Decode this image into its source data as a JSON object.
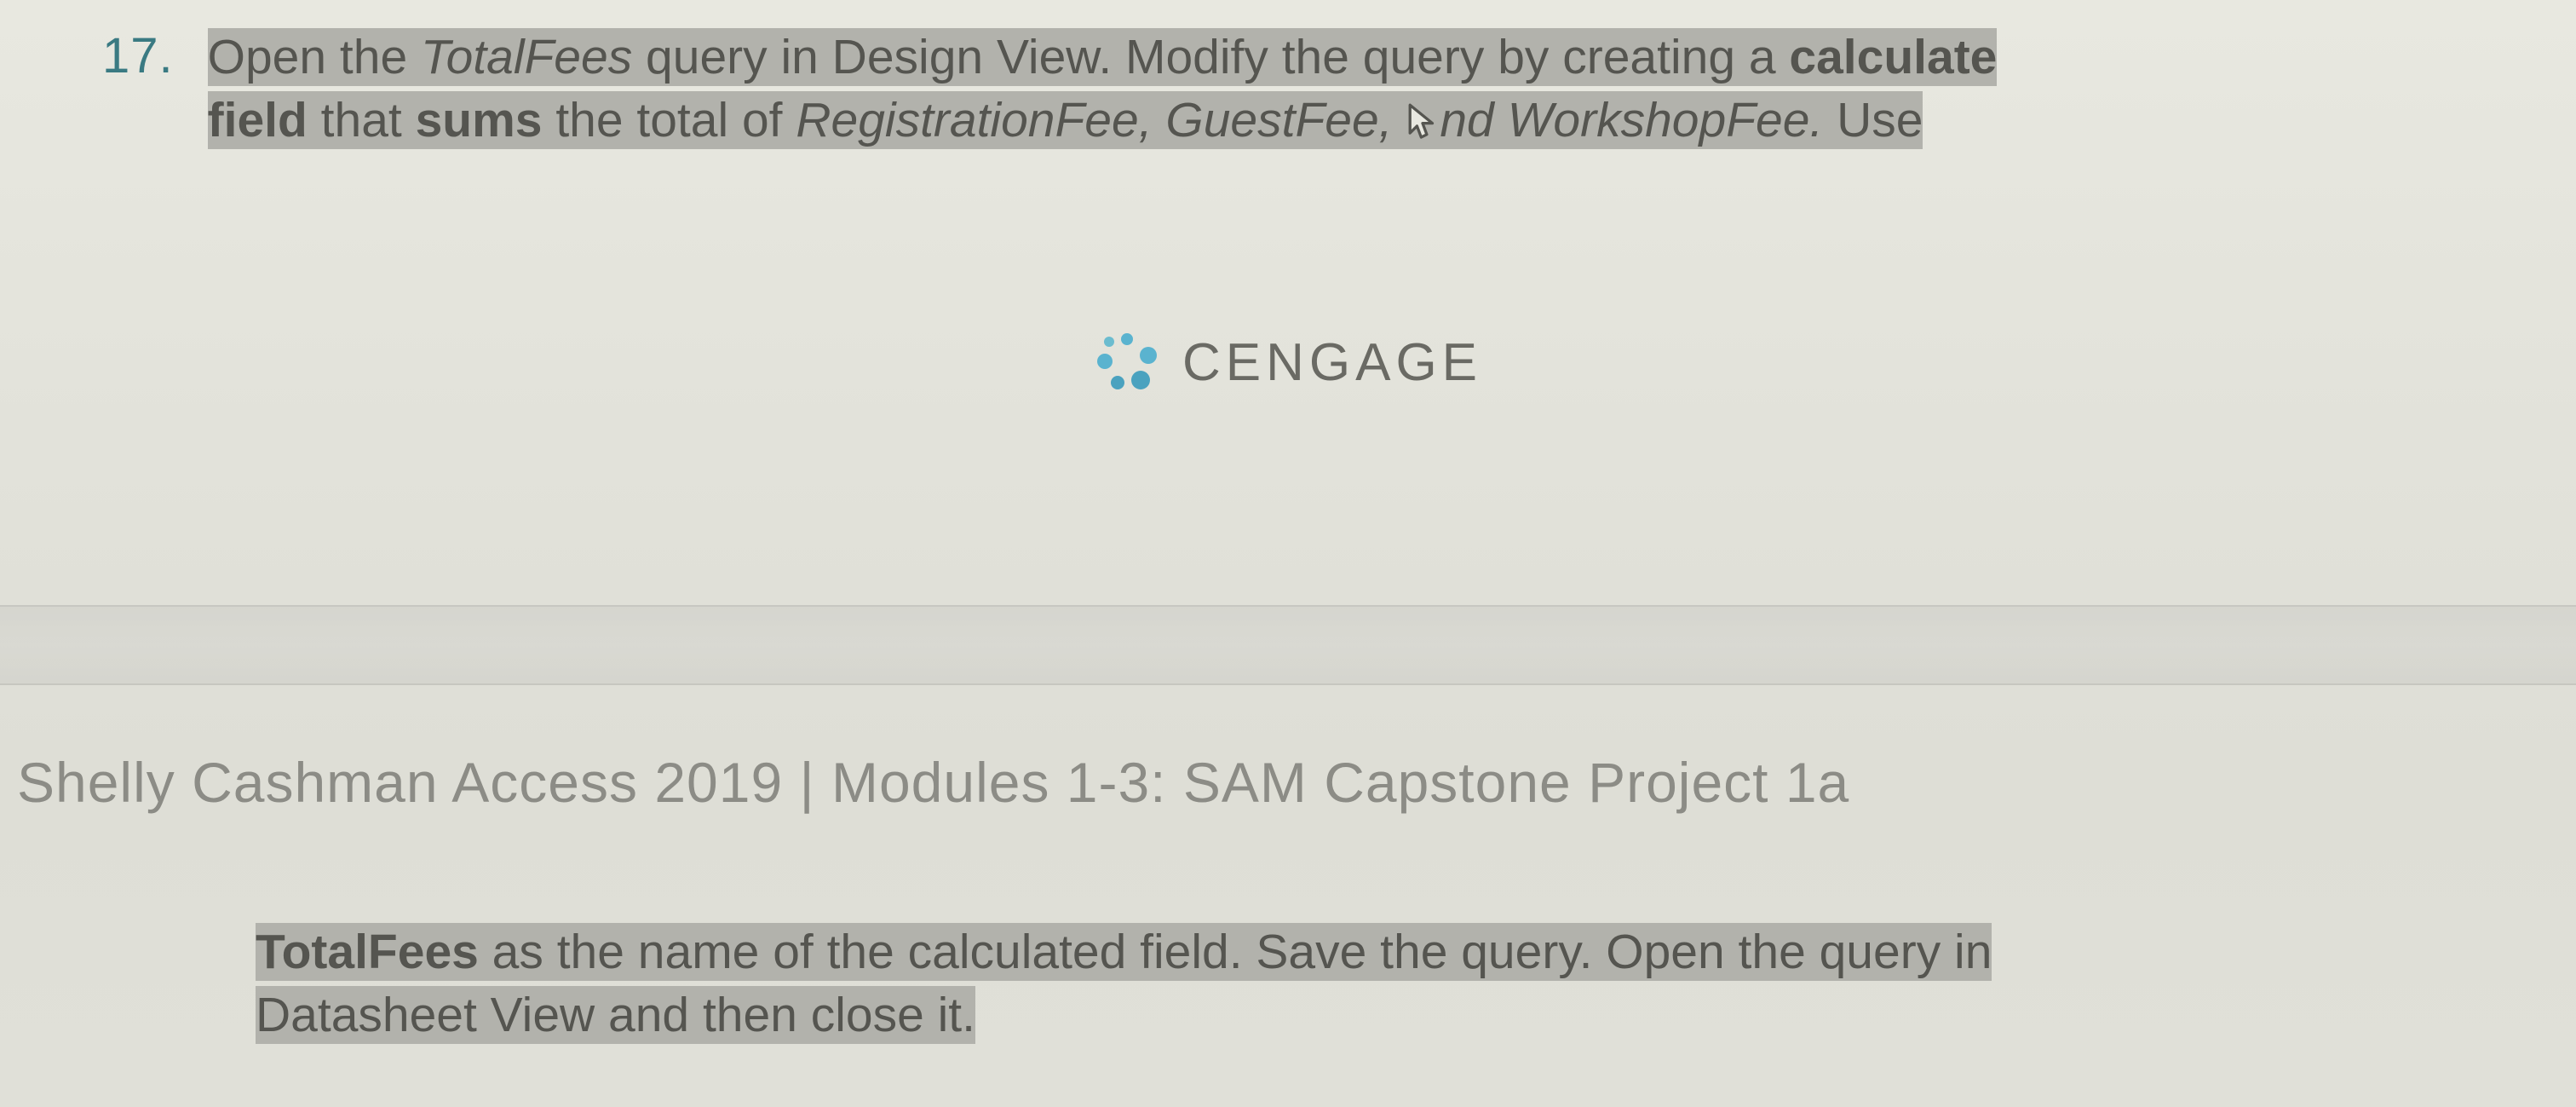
{
  "item_number": "17.",
  "top": {
    "hl_open_the": "Open the ",
    "hl_totalfees": "TotalFees",
    "hl_query_in": " query in Design View. Modify the query by creating a ",
    "hl_calculate": "calculate",
    "hl_field": "field",
    "hl_that": " that ",
    "hl_sums": "sums",
    "hl_the_total_of": " the total of ",
    "hl_regfee": "RegistrationFee, GuestFee,",
    "hl_and_space": " ",
    "hl_and_text": "nd ",
    "hl_workshopfee": "WorkshopFee.",
    "hl_use": " Use"
  },
  "logo": {
    "name": "CENGAGE"
  },
  "heading": {
    "text_a": "Shelly Cashman Access 2019 ",
    "text_sep": "|",
    "text_b": " Modules 1-3: SAM Capstone Project 1a"
  },
  "bottom": {
    "hl_totalfees": "TotalFees",
    "hl_rest1": " as the name of the calculated field. Save the query. Open the query in",
    "hl_rest2": "Datasheet View and then close it."
  }
}
